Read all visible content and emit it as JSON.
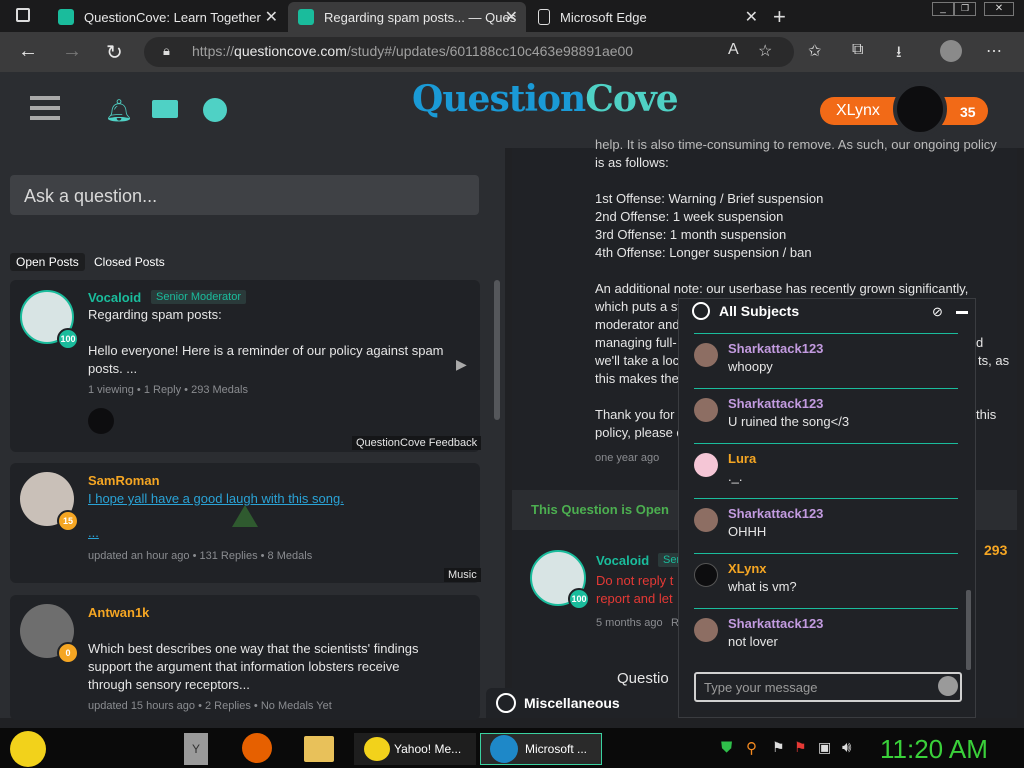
{
  "browser": {
    "tabs": [
      {
        "title": "QuestionCove: Learn Together"
      },
      {
        "title": "Regarding spam posts... — Ques"
      },
      {
        "title": "Microsoft Edge"
      }
    ],
    "url_prefix": "https://",
    "url_domain": "questioncove.com",
    "url_path": "/study#/updates/601188cc10c463e98891ae00"
  },
  "site": {
    "logo": {
      "part1": "Question",
      "part2": "Cove"
    },
    "user": {
      "name": "XLynx",
      "medals": "35"
    }
  },
  "left": {
    "ask_placeholder": "Ask a question...",
    "filters": {
      "open": "Open Posts",
      "closed": "Closed Posts"
    },
    "posts": [
      {
        "author": "Vocaloid",
        "role": "Senior Moderator",
        "badge": "100",
        "title": "Regarding spam posts:",
        "body": "Hello everyone! Here is a reminder of our policy against spam posts. ...",
        "meta": "1 viewing  •  1 Reply  •  293 Medals",
        "category": "QuestionCove Feedback"
      },
      {
        "author": "SamRoman",
        "badge": "15",
        "link": "I hope yall have a good laugh with this song.",
        "ellipsis": "...",
        "meta": "updated an hour ago  •  131 Replies  •  8 Medals",
        "category": "Music"
      },
      {
        "author": "Antwan1k",
        "badge": "0",
        "body": "Which best describes one way that the scientists' findings support the argument that information lobsters receive through sensory receptors...",
        "meta": "updated 15 hours ago  •  2 Replies  •  No Medals Yet"
      }
    ]
  },
  "right": {
    "lines": [
      "help. It is also time-consuming to remove. As such, our ongoing policy",
      "is as follows:",
      "1st Offense: Warning / Brief suspension",
      "2nd Offense: 1 week suspension",
      "3rd Offense: 1 month suspension",
      "4th Offense: Longer suspension / ban",
      "An additional note: our userbase has recently grown significantly,",
      "which puts a st",
      "moderator and",
      "managing full-",
      "we'll take a loc",
      "this makes the",
      "Thank you for",
      "policy, please c"
    ],
    "right_frags": [
      "d",
      "ts, as",
      "this"
    ],
    "timestamp": "one year ago",
    "open_question": "This Question is Open",
    "reply": {
      "author": "Vocaloid",
      "role_fragment": "Sen",
      "badge": "100",
      "line1": "Do not reply t",
      "line2": "report and let",
      "time": "5 months ago",
      "time_suffix": "R"
    },
    "medals": "293",
    "question_fragment": "Questio"
  },
  "chat": {
    "title": "All Subjects",
    "messages": [
      {
        "user": "Sharkattack123",
        "text": "whoopy",
        "color": "#c39be0"
      },
      {
        "user": "Sharkattack123",
        "text": "U ruined the song</3",
        "color": "#c39be0"
      },
      {
        "user": "Lura",
        "text": "._.",
        "color": "#f5a623"
      },
      {
        "user": "Sharkattack123",
        "text": "OHHH",
        "color": "#c39be0"
      },
      {
        "user": "XLynx",
        "text": "what is vm?",
        "color": "#f5a623"
      },
      {
        "user": "Sharkattack123",
        "text": "not lover",
        "color": "#c39be0"
      }
    ],
    "input_placeholder": "Type your message",
    "misc_tab": "Miscellaneous"
  },
  "taskbar": {
    "items": [
      {
        "label": "Y"
      },
      {
        "label": "Yahoo! Me..."
      },
      {
        "label": "Microsoft ..."
      }
    ],
    "clock": "11:20 AM"
  }
}
